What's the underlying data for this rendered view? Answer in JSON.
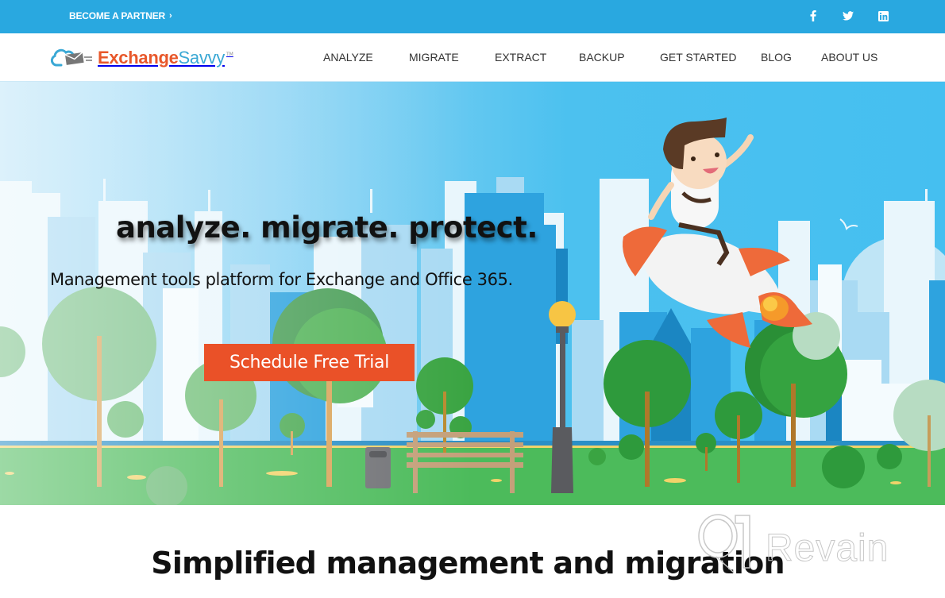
{
  "topbar": {
    "partner_label": "BECOME A PARTNER",
    "partner_icon": "chevron-right-icon",
    "socials": [
      {
        "name": "facebook",
        "icon": "facebook-icon"
      },
      {
        "name": "twitter",
        "icon": "twitter-icon"
      },
      {
        "name": "linkedin",
        "icon": "linkedin-icon"
      }
    ],
    "bg_color": "#29a8e0"
  },
  "header": {
    "logo": {
      "part1": "Exchange",
      "part2": "Savvy",
      "tm": "TM",
      "icon": "cloud-envelope-icon",
      "colors": {
        "part1": "#e8582b",
        "part2": "#3aa8d5"
      }
    },
    "nav": [
      {
        "label": "ANALYZE"
      },
      {
        "label": "MIGRATE"
      },
      {
        "label": "EXTRACT"
      },
      {
        "label": "BACKUP"
      },
      {
        "label": "GET STARTED"
      },
      {
        "label": "BLOG"
      },
      {
        "label": "ABOUT US"
      }
    ]
  },
  "hero": {
    "title": "analyze. migrate. protect.",
    "subtitle": "Management tools platform for Exchange and Office 365.",
    "cta_label": "Schedule Free Trial",
    "cta_color": "#ea5128",
    "illustration": "city-park-rocket-man-illustration"
  },
  "section": {
    "title": "Simplified management and migration"
  },
  "watermark": {
    "text": "Revain"
  }
}
